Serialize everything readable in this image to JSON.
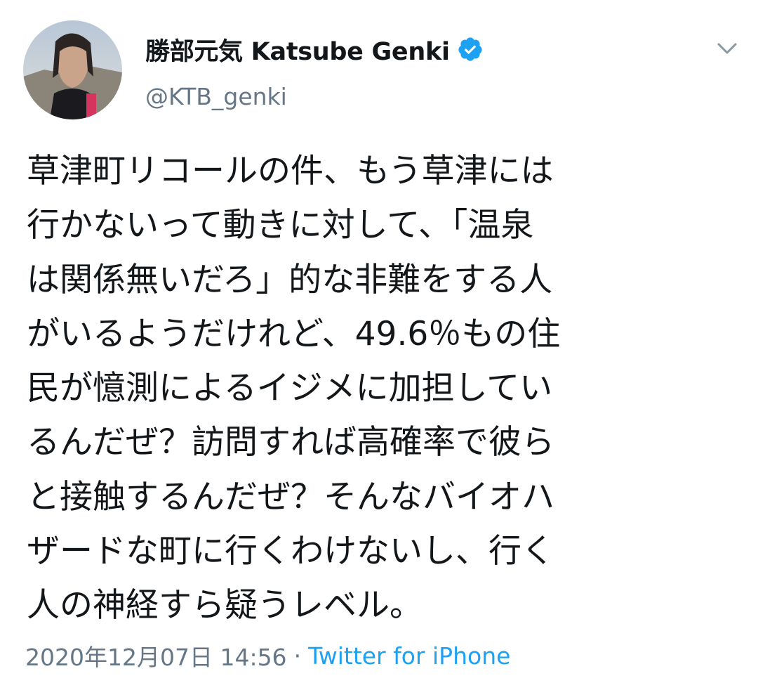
{
  "author": {
    "display_name": "勝部元気 Katsube Genki",
    "handle": "@KTB_genki",
    "verified": true
  },
  "tweet": {
    "text_lines": [
      "草津町リコールの件、もう草津には",
      "行かないって動きに対して、「温泉",
      "は関係無いだろ」的な非難をする人",
      "がいるようだけれど、49.6％もの住",
      "民が憶測によるイジメに加担してい",
      "るんだぜ？訪問すれば高確率で彼ら",
      "と接触するんだぜ？そんなバイオハ",
      "ザードな町に行くわけないし、行く",
      "人の神経すら疑うレベル。"
    ],
    "timestamp": "2020年12月07日 14:56",
    "separator": "·",
    "source": "Twitter for iPhone"
  },
  "icons": {
    "verified": "verified-badge-icon",
    "caret": "chevron-down-icon"
  },
  "colors": {
    "text": "#14171a",
    "secondary": "#657786",
    "accent": "#1da1f2"
  }
}
